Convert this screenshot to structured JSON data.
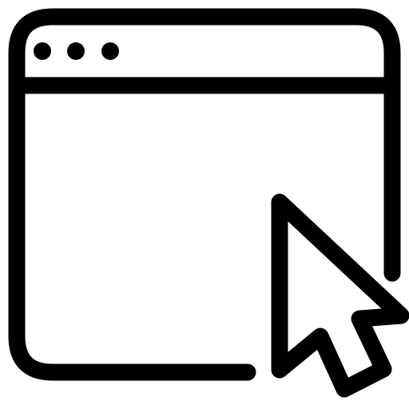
{
  "icon": {
    "name": "browser-window-with-cursor",
    "stroke_color": "#000000",
    "fill_color": "#ffffff"
  },
  "window": {
    "title_bar_dots": 3
  },
  "cursor": {
    "name": "mouse-pointer-icon"
  }
}
